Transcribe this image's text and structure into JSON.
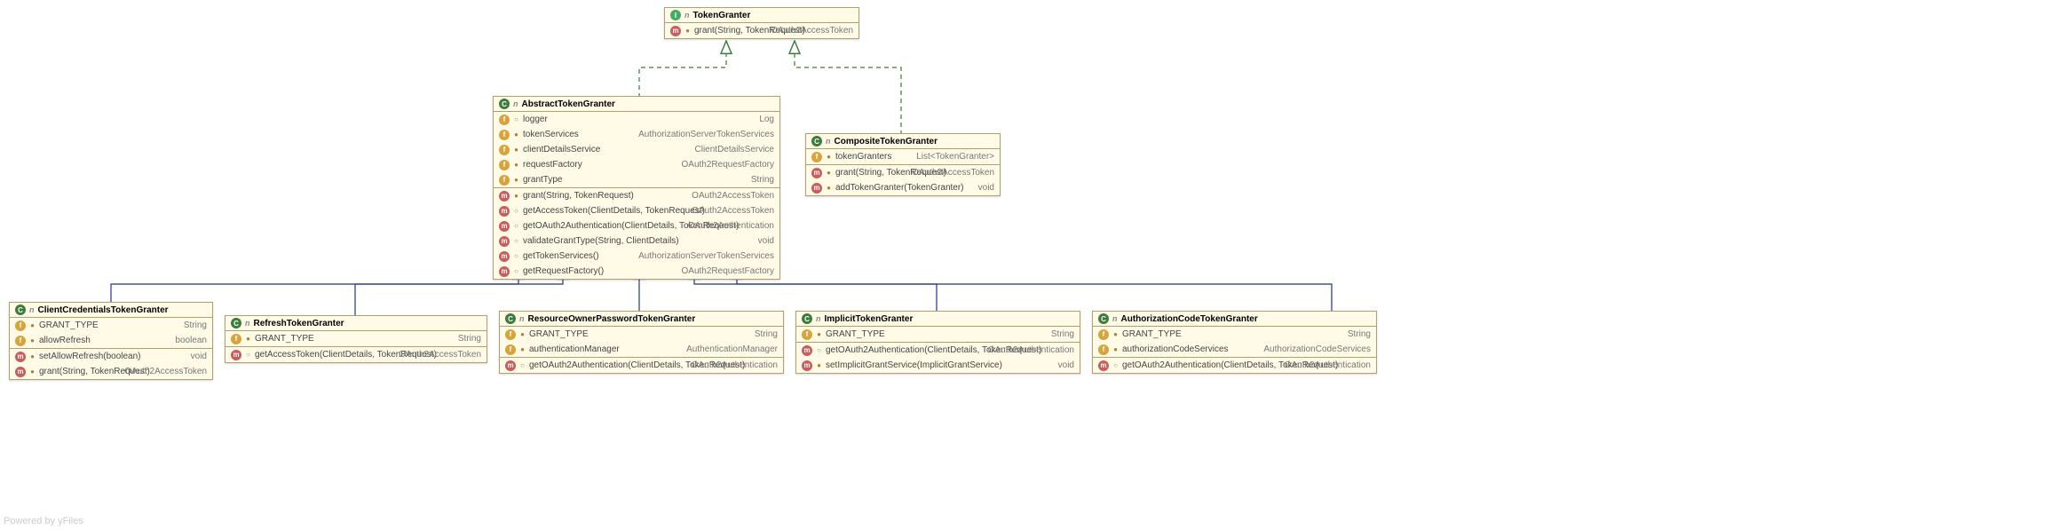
{
  "footer": "Powered by yFiles",
  "classes": {
    "TokenGranter": {
      "stereotype": "I",
      "name": "TokenGranter",
      "methods": [
        {
          "kind": "m",
          "vis": "lock",
          "name": "grant(String, TokenRequest)",
          "type": "OAuth2AccessToken"
        }
      ]
    },
    "AbstractTokenGranter": {
      "stereotype": "C",
      "abstract": true,
      "name": "AbstractTokenGranter",
      "fields": [
        {
          "kind": "f",
          "vis": "open",
          "name": "logger",
          "type": "Log"
        },
        {
          "kind": "f",
          "vis": "lock",
          "name": "tokenServices",
          "type": "AuthorizationServerTokenServices"
        },
        {
          "kind": "f",
          "vis": "lock",
          "name": "clientDetailsService",
          "type": "ClientDetailsService"
        },
        {
          "kind": "f",
          "vis": "lock",
          "name": "requestFactory",
          "type": "OAuth2RequestFactory"
        },
        {
          "kind": "f",
          "vis": "lock",
          "name": "grantType",
          "type": "String"
        }
      ],
      "methods": [
        {
          "kind": "m",
          "vis": "lock",
          "name": "grant(String, TokenRequest)",
          "type": "OAuth2AccessToken"
        },
        {
          "kind": "m",
          "vis": "open",
          "name": "getAccessToken(ClientDetails, TokenRequest)",
          "type": "OAuth2AccessToken"
        },
        {
          "kind": "m",
          "vis": "open",
          "name": "getOAuth2Authentication(ClientDetails, TokenRequest)",
          "type": "OAuth2Authentication"
        },
        {
          "kind": "m",
          "vis": "open",
          "name": "validateGrantType(String, ClientDetails)",
          "type": "void"
        },
        {
          "kind": "m",
          "vis": "open",
          "name": "getTokenServices()",
          "type": "AuthorizationServerTokenServices"
        },
        {
          "kind": "m",
          "vis": "open",
          "name": "getRequestFactory()",
          "type": "OAuth2RequestFactory"
        }
      ]
    },
    "CompositeTokenGranter": {
      "stereotype": "C",
      "name": "CompositeTokenGranter",
      "fields": [
        {
          "kind": "f",
          "vis": "lock",
          "name": "tokenGranters",
          "type": "List<TokenGranter>"
        }
      ],
      "methods": [
        {
          "kind": "m",
          "vis": "lock",
          "name": "grant(String, TokenRequest)",
          "type": "OAuth2AccessToken"
        },
        {
          "kind": "m",
          "vis": "lock",
          "name": "addTokenGranter(TokenGranter)",
          "type": "void"
        }
      ]
    },
    "ClientCredentialsTokenGranter": {
      "stereotype": "C",
      "name": "ClientCredentialsTokenGranter",
      "fields": [
        {
          "kind": "f",
          "vis": "lock",
          "name": "GRANT_TYPE",
          "type": "String"
        },
        {
          "kind": "f",
          "vis": "lock",
          "name": "allowRefresh",
          "type": "boolean"
        }
      ],
      "methods": [
        {
          "kind": "m",
          "vis": "lock",
          "name": "setAllowRefresh(boolean)",
          "type": "void"
        },
        {
          "kind": "m",
          "vis": "lock",
          "name": "grant(String, TokenRequest)",
          "type": "OAuth2AccessToken"
        }
      ]
    },
    "RefreshTokenGranter": {
      "stereotype": "C",
      "name": "RefreshTokenGranter",
      "fields": [
        {
          "kind": "f",
          "vis": "lock",
          "name": "GRANT_TYPE",
          "type": "String"
        }
      ],
      "methods": [
        {
          "kind": "m",
          "vis": "open",
          "name": "getAccessToken(ClientDetails, TokenRequest)",
          "type": "OAuth2AccessToken"
        }
      ]
    },
    "ResourceOwnerPasswordTokenGranter": {
      "stereotype": "C",
      "name": "ResourceOwnerPasswordTokenGranter",
      "fields": [
        {
          "kind": "f",
          "vis": "lock",
          "name": "GRANT_TYPE",
          "type": "String"
        },
        {
          "kind": "f",
          "vis": "lock",
          "name": "authenticationManager",
          "type": "AuthenticationManager"
        }
      ],
      "methods": [
        {
          "kind": "m",
          "vis": "open",
          "name": "getOAuth2Authentication(ClientDetails, TokenRequest)",
          "type": "OAuth2Authentication"
        }
      ]
    },
    "ImplicitTokenGranter": {
      "stereotype": "C",
      "name": "ImplicitTokenGranter",
      "fields": [
        {
          "kind": "f",
          "vis": "lock",
          "name": "GRANT_TYPE",
          "type": "String"
        }
      ],
      "methods": [
        {
          "kind": "m",
          "vis": "open",
          "name": "getOAuth2Authentication(ClientDetails, TokenRequest)",
          "type": "OAuth2Authentication"
        },
        {
          "kind": "m",
          "vis": "lock",
          "name": "setImplicitGrantService(ImplicitGrantService)",
          "type": "void"
        }
      ]
    },
    "AuthorizationCodeTokenGranter": {
      "stereotype": "C",
      "name": "AuthorizationCodeTokenGranter",
      "fields": [
        {
          "kind": "f",
          "vis": "lock",
          "name": "GRANT_TYPE",
          "type": "String"
        },
        {
          "kind": "f",
          "vis": "lock",
          "name": "authorizationCodeServices",
          "type": "AuthorizationCodeServices"
        }
      ],
      "methods": [
        {
          "kind": "m",
          "vis": "open",
          "name": "getOAuth2Authentication(ClientDetails, TokenRequest)",
          "type": "OAuth2Authentication"
        }
      ]
    }
  }
}
